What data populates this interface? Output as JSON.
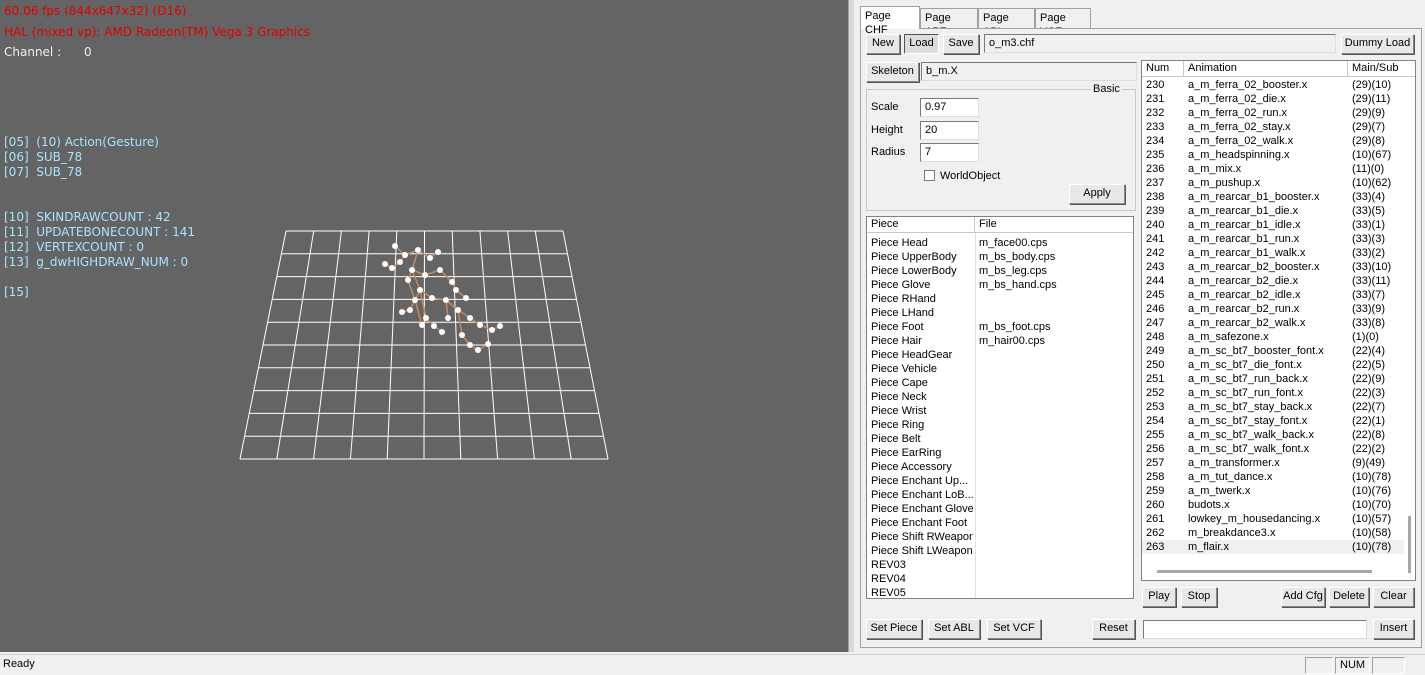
{
  "viewport": {
    "fps_line": "60.06 fps (844x647x32) (D16)",
    "hal_line": "HAL (mixed vp): AMD Radeon(TM) Vega 3 Graphics",
    "channel_label": "Channel :",
    "channel_value": "0",
    "debug_lines": [
      "[05]  (10) Action(Gesture)",
      "[06]  SUB_78",
      "[07]  SUB_78",
      "[10]  SKINDRAWCOUNT : 42",
      "[11]  UPDATEBONECOUNT : 141",
      "[12]  VERTEXCOUNT : 0",
      "[13]  g_dwHIGHDRAW_NUM : 0",
      "[15]"
    ]
  },
  "tabs": [
    "Page CHF",
    "Page ABF",
    "Page ABL",
    "Page VCF"
  ],
  "toolbar": {
    "new_label": "New",
    "load_label": "Load",
    "save_label": "Save",
    "file_value": "o_m3.chf",
    "dummy_load_label": "Dummy Load"
  },
  "skeleton": {
    "button_label": "Skeleton",
    "value": "b_m.X"
  },
  "basic": {
    "group_label": "Basic",
    "scale_label": "Scale",
    "scale_value": "0.97",
    "height_label": "Height",
    "height_value": "20",
    "radius_label": "Radius",
    "radius_value": "7",
    "world_object_label": "WorldObject",
    "apply_label": "Apply"
  },
  "pieces": {
    "headers": [
      "Piece",
      "File"
    ],
    "rows": [
      [
        "Piece Head",
        "m_face00.cps"
      ],
      [
        "Piece UpperBody",
        "m_bs_body.cps"
      ],
      [
        "Piece LowerBody",
        "m_bs_leg.cps"
      ],
      [
        "Piece Glove",
        "m_bs_hand.cps"
      ],
      [
        "Piece RHand",
        ""
      ],
      [
        "Piece LHand",
        ""
      ],
      [
        "Piece Foot",
        "m_bs_foot.cps"
      ],
      [
        "Piece Hair",
        "m_hair00.cps"
      ],
      [
        "Piece HeadGear",
        ""
      ],
      [
        "Piece Vehicle",
        ""
      ],
      [
        "Piece Cape",
        ""
      ],
      [
        "Piece Neck",
        ""
      ],
      [
        "Piece Wrist",
        ""
      ],
      [
        "Piece Ring",
        ""
      ],
      [
        "Piece Belt",
        ""
      ],
      [
        "Piece EarRing",
        ""
      ],
      [
        "Piece Accessory",
        ""
      ],
      [
        "Piece Enchant Up...",
        ""
      ],
      [
        "Piece Enchant LoB...",
        ""
      ],
      [
        "Piece Enchant Glove",
        ""
      ],
      [
        "Piece Enchant Foot",
        ""
      ],
      [
        "Piece Shift RWeapon",
        ""
      ],
      [
        "Piece Shift LWeapon",
        ""
      ],
      [
        "REV03",
        ""
      ],
      [
        "REV04",
        ""
      ],
      [
        "REV05",
        ""
      ]
    ],
    "set_piece_label": "Set Piece",
    "set_abl_label": "Set ABL",
    "set_vcf_label": "Set VCF",
    "reset_label": "Reset"
  },
  "animations": {
    "headers": [
      "Num",
      "Animation",
      "Main/Sub"
    ],
    "rows": [
      [
        "230",
        "a_m_ferra_02_booster.x",
        "(29)(10)"
      ],
      [
        "231",
        "a_m_ferra_02_die.x",
        "(29)(11)"
      ],
      [
        "232",
        "a_m_ferra_02_run.x",
        "(29)(9)"
      ],
      [
        "233",
        "a_m_ferra_02_stay.x",
        "(29)(7)"
      ],
      [
        "234",
        "a_m_ferra_02_walk.x",
        "(29)(8)"
      ],
      [
        "235",
        "a_m_headspinning.x",
        "(10)(67)"
      ],
      [
        "236",
        "a_m_mix.x",
        "(11)(0)"
      ],
      [
        "237",
        "a_m_pushup.x",
        "(10)(62)"
      ],
      [
        "238",
        "a_m_rearcar_b1_booster.x",
        "(33)(4)"
      ],
      [
        "239",
        "a_m_rearcar_b1_die.x",
        "(33)(5)"
      ],
      [
        "240",
        "a_m_rearcar_b1_idle.x",
        "(33)(1)"
      ],
      [
        "241",
        "a_m_rearcar_b1_run.x",
        "(33)(3)"
      ],
      [
        "242",
        "a_m_rearcar_b1_walk.x",
        "(33)(2)"
      ],
      [
        "243",
        "a_m_rearcar_b2_booster.x",
        "(33)(10)"
      ],
      [
        "244",
        "a_m_rearcar_b2_die.x",
        "(33)(11)"
      ],
      [
        "245",
        "a_m_rearcar_b2_idle.x",
        "(33)(7)"
      ],
      [
        "246",
        "a_m_rearcar_b2_run.x",
        "(33)(9)"
      ],
      [
        "247",
        "a_m_rearcar_b2_walk.x",
        "(33)(8)"
      ],
      [
        "248",
        "a_m_safezone.x",
        "(1)(0)"
      ],
      [
        "249",
        "a_m_sc_bt7_booster_font.x",
        "(22)(4)"
      ],
      [
        "250",
        "a_m_sc_bt7_die_font.x",
        "(22)(5)"
      ],
      [
        "251",
        "a_m_sc_bt7_run_back.x",
        "(22)(9)"
      ],
      [
        "252",
        "a_m_sc_bt7_run_font.x",
        "(22)(3)"
      ],
      [
        "253",
        "a_m_sc_bt7_stay_back.x",
        "(22)(7)"
      ],
      [
        "254",
        "a_m_sc_bt7_stay_font.x",
        "(22)(1)"
      ],
      [
        "255",
        "a_m_sc_bt7_walk_back.x",
        "(22)(8)"
      ],
      [
        "256",
        "a_m_sc_bt7_walk_font.x",
        "(22)(2)"
      ],
      [
        "257",
        "a_m_transformer.x",
        "(9)(49)"
      ],
      [
        "258",
        "a_m_tut_dance.x",
        "(10)(78)"
      ],
      [
        "259",
        "a_m_twerk.x",
        "(10)(76)"
      ],
      [
        "260",
        "budots.x",
        "(10)(70)"
      ],
      [
        "261",
        "lowkey_m_housedancing.x",
        "(10)(57)"
      ],
      [
        "262",
        "m_breakdance3.x",
        "(10)(58)"
      ],
      [
        "263",
        "m_flair.x",
        "(10)(78)"
      ]
    ],
    "play_label": "Play",
    "stop_label": "Stop",
    "add_cfg_label": "Add Cfg",
    "delete_label": "Delete",
    "clear_label": "Clear",
    "insert_value": "",
    "insert_label": "Insert"
  },
  "status": {
    "ready": "Ready",
    "num": "NUM"
  },
  "colors": {
    "viewport_bg": "#646464",
    "overlay_red": "#e00000",
    "overlay_cyan": "#a8e4ff"
  }
}
